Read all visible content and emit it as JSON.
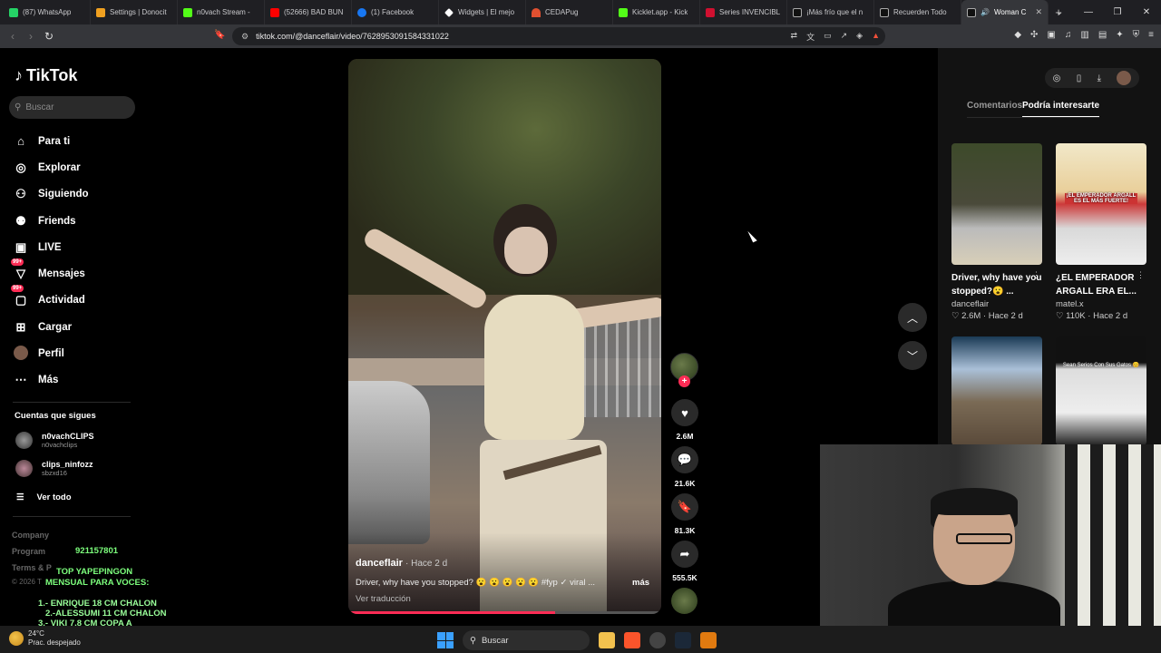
{
  "browser": {
    "tabs": [
      {
        "label": "(87) WhatsApp",
        "color": "#25d366"
      },
      {
        "label": "Settings | Donocit",
        "color": "#f0a020"
      },
      {
        "label": "n0vach Stream -",
        "color": "#53fc18"
      },
      {
        "label": "(52666) BAD BUN",
        "color": "#ff0000"
      },
      {
        "label": "(1) Facebook",
        "color": "#1877f2"
      },
      {
        "label": "Widgets | El mejo",
        "color": "#ffffff"
      },
      {
        "label": "CEDAPug",
        "color": "#e05030"
      },
      {
        "label": "Kicklet.app - Kick",
        "color": "#53fc18"
      },
      {
        "label": "Series INVENCIBL",
        "color": "#d01030"
      },
      {
        "label": "¡Más frío que el n",
        "color": "#ffffff"
      },
      {
        "label": "Recuerden Todo",
        "color": "#ffffff"
      },
      {
        "label": "Woman C",
        "color": "#ffffff",
        "active": true
      }
    ],
    "url": "tiktok.com/@danceflair/video/7628953091584331022"
  },
  "sidebar": {
    "logo": "TikTok",
    "search_placeholder": "Buscar",
    "nav": [
      {
        "label": "Para ti",
        "icon": "home-icon"
      },
      {
        "label": "Explorar",
        "icon": "compass-icon"
      },
      {
        "label": "Siguiendo",
        "icon": "following-icon"
      },
      {
        "label": "Friends",
        "icon": "friends-icon"
      },
      {
        "label": "LIVE",
        "icon": "live-icon"
      },
      {
        "label": "Mensajes",
        "icon": "messages-icon",
        "badge": "99+"
      },
      {
        "label": "Actividad",
        "icon": "activity-icon",
        "badge": "99+"
      },
      {
        "label": "Cargar",
        "icon": "upload-icon"
      },
      {
        "label": "Perfil",
        "icon": "profile-avatar"
      },
      {
        "label": "Más",
        "icon": "more-icon"
      }
    ],
    "following_title": "Cuentas que sigues",
    "following": [
      {
        "name": "n0vachCLIPS",
        "handle": "n0vachclips"
      },
      {
        "name": "clips_ninfozz",
        "handle": "sbzxd16"
      }
    ],
    "see_all": "Ver todo",
    "footer": [
      "Company",
      "Program",
      "Terms & P",
      "© 2026 T"
    ]
  },
  "overlay": {
    "number": "921157801",
    "title": "TOP YAPEPINGON",
    "subtitle": "MENSUAL PARA VOCES:",
    "lines": [
      "1.- ENRIQUE 18 CM CHALON",
      "2.-ALESSUMI 11 CM CHALON",
      "3.- VIKI 7.8 CM COPA A"
    ]
  },
  "video": {
    "author": "danceflair",
    "time": "· Hace 2 d",
    "description": "Driver, why have you stopped? 😮 😮 😮 😮 😮 #fyp ✓ viral ...",
    "more": "más",
    "translate": "Ver traducción",
    "progress": 0.66,
    "likes": "2.6M",
    "comments": "21.6K",
    "saves": "81.3K",
    "shares": "555.5K"
  },
  "rpanel": {
    "tab_comments": "Comentarios",
    "tab_related": "Podría interesarte",
    "cards": [
      {
        "title": "Driver, why have you stopped?😮 ...",
        "author": "danceflair",
        "likes": "♡ 2.6M",
        "time": "· Hace 2 d"
      },
      {
        "title": "¿EL EMPERADOR ARGALL ERA EL...",
        "author": "matel.x",
        "likes": "♡ 110K",
        "time": "· Hace 2 d",
        "caption": "¡EL EMPERADOR ARGALL ES EL MÁS FUERTE!"
      },
      {
        "title": "",
        "author": "",
        "likes": "",
        "time": ""
      },
      {
        "title": "",
        "author": "",
        "likes": "",
        "time": "",
        "caption": "Sean Serios Con Sus Gatos 😊"
      }
    ]
  },
  "taskbar": {
    "temp": "24°C",
    "weather": "Prac. despejado",
    "search": "Buscar"
  }
}
